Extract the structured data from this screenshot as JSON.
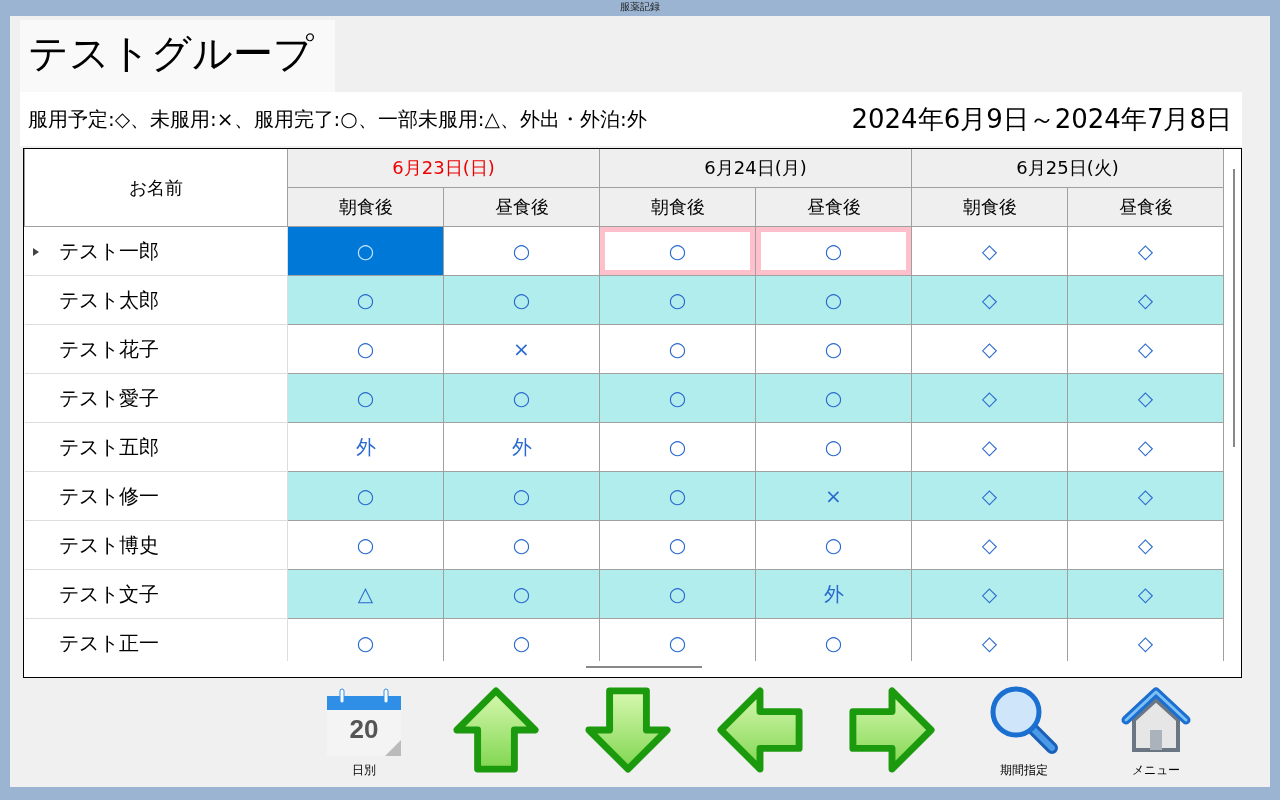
{
  "window": {
    "title": "服薬記録"
  },
  "group_tab": {
    "label": "テストグループ"
  },
  "legend": {
    "text": "服用予定:◇、未服用:×、服用完了:○、一部未服用:△、外出・外泊:外",
    "period": "2024年6月9日～2024年7月8日"
  },
  "table": {
    "name_header": "お名前",
    "dates": [
      {
        "label": "6月23日(日)",
        "holiday": true,
        "meals": [
          "朝食後",
          "昼食後"
        ]
      },
      {
        "label": "6月24日(月)",
        "holiday": false,
        "meals": [
          "朝食後",
          "昼食後"
        ]
      },
      {
        "label": "6月25日(火)",
        "holiday": false,
        "meals": [
          "朝食後",
          "昼食後"
        ]
      }
    ],
    "rows": [
      {
        "name": "テスト一郎",
        "current": true,
        "cells": [
          {
            "mark": "○",
            "selected": true,
            "outlined": false
          },
          {
            "mark": "○",
            "selected": false,
            "outlined": false
          },
          {
            "mark": "○",
            "selected": false,
            "outlined": true
          },
          {
            "mark": "○",
            "selected": false,
            "outlined": true
          },
          {
            "mark": "◇",
            "selected": false,
            "outlined": false
          },
          {
            "mark": "◇",
            "selected": false,
            "outlined": false
          }
        ]
      },
      {
        "name": "テスト太郎",
        "current": false,
        "cells": [
          {
            "mark": "○",
            "selected": false,
            "outlined": false
          },
          {
            "mark": "○",
            "selected": false,
            "outlined": false
          },
          {
            "mark": "○",
            "selected": false,
            "outlined": false
          },
          {
            "mark": "○",
            "selected": false,
            "outlined": false
          },
          {
            "mark": "◇",
            "selected": false,
            "outlined": false
          },
          {
            "mark": "◇",
            "selected": false,
            "outlined": false
          }
        ]
      },
      {
        "name": "テスト花子",
        "current": false,
        "cells": [
          {
            "mark": "○",
            "selected": false,
            "outlined": false
          },
          {
            "mark": "×",
            "selected": false,
            "outlined": false
          },
          {
            "mark": "○",
            "selected": false,
            "outlined": false
          },
          {
            "mark": "○",
            "selected": false,
            "outlined": false
          },
          {
            "mark": "◇",
            "selected": false,
            "outlined": false
          },
          {
            "mark": "◇",
            "selected": false,
            "outlined": false
          }
        ]
      },
      {
        "name": "テスト愛子",
        "current": false,
        "cells": [
          {
            "mark": "○",
            "selected": false,
            "outlined": false
          },
          {
            "mark": "○",
            "selected": false,
            "outlined": false
          },
          {
            "mark": "○",
            "selected": false,
            "outlined": false
          },
          {
            "mark": "○",
            "selected": false,
            "outlined": false
          },
          {
            "mark": "◇",
            "selected": false,
            "outlined": false
          },
          {
            "mark": "◇",
            "selected": false,
            "outlined": false
          }
        ]
      },
      {
        "name": "テスト五郎",
        "current": false,
        "cells": [
          {
            "mark": "外",
            "selected": false,
            "outlined": false
          },
          {
            "mark": "外",
            "selected": false,
            "outlined": false
          },
          {
            "mark": "○",
            "selected": false,
            "outlined": false
          },
          {
            "mark": "○",
            "selected": false,
            "outlined": false
          },
          {
            "mark": "◇",
            "selected": false,
            "outlined": false
          },
          {
            "mark": "◇",
            "selected": false,
            "outlined": false
          }
        ]
      },
      {
        "name": "テスト修一",
        "current": false,
        "cells": [
          {
            "mark": "○",
            "selected": false,
            "outlined": false
          },
          {
            "mark": "○",
            "selected": false,
            "outlined": false
          },
          {
            "mark": "○",
            "selected": false,
            "outlined": false
          },
          {
            "mark": "×",
            "selected": false,
            "outlined": false
          },
          {
            "mark": "◇",
            "selected": false,
            "outlined": false
          },
          {
            "mark": "◇",
            "selected": false,
            "outlined": false
          }
        ]
      },
      {
        "name": "テスト博史",
        "current": false,
        "cells": [
          {
            "mark": "○",
            "selected": false,
            "outlined": false
          },
          {
            "mark": "○",
            "selected": false,
            "outlined": false
          },
          {
            "mark": "○",
            "selected": false,
            "outlined": false
          },
          {
            "mark": "○",
            "selected": false,
            "outlined": false
          },
          {
            "mark": "◇",
            "selected": false,
            "outlined": false
          },
          {
            "mark": "◇",
            "selected": false,
            "outlined": false
          }
        ]
      },
      {
        "name": "テスト文子",
        "current": false,
        "cells": [
          {
            "mark": "△",
            "selected": false,
            "outlined": false
          },
          {
            "mark": "○",
            "selected": false,
            "outlined": false
          },
          {
            "mark": "○",
            "selected": false,
            "outlined": false
          },
          {
            "mark": "外",
            "selected": false,
            "outlined": false
          },
          {
            "mark": "◇",
            "selected": false,
            "outlined": false
          },
          {
            "mark": "◇",
            "selected": false,
            "outlined": false
          }
        ]
      },
      {
        "name": "テスト正一",
        "current": false,
        "cells": [
          {
            "mark": "○",
            "selected": false,
            "outlined": false
          },
          {
            "mark": "○",
            "selected": false,
            "outlined": false
          },
          {
            "mark": "○",
            "selected": false,
            "outlined": false
          },
          {
            "mark": "○",
            "selected": false,
            "outlined": false
          },
          {
            "mark": "◇",
            "selected": false,
            "outlined": false
          },
          {
            "mark": "◇",
            "selected": false,
            "outlined": false
          }
        ]
      }
    ]
  },
  "toolbar": [
    {
      "kind": "calendar",
      "label": "日別",
      "day": "20"
    },
    {
      "kind": "up"
    },
    {
      "kind": "down"
    },
    {
      "kind": "left"
    },
    {
      "kind": "right"
    },
    {
      "kind": "search",
      "label": "期間指定"
    },
    {
      "kind": "home",
      "label": "メニュー"
    }
  ]
}
